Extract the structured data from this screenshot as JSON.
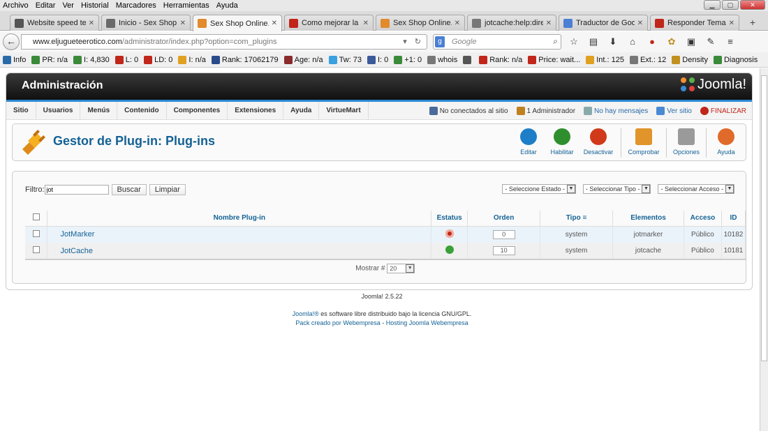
{
  "browser": {
    "menu": [
      "Archivo",
      "Editar",
      "Ver",
      "Historial",
      "Marcadores",
      "Herramientas",
      "Ayuda"
    ],
    "tabs": [
      {
        "label": "Website speed test",
        "color": "#555"
      },
      {
        "label": "Inicio - Sex Shop ...",
        "color": "#6a6a6a"
      },
      {
        "label": "Sex Shop Online. ...",
        "color": "#e28a2c",
        "active": true
      },
      {
        "label": "Como mejorar la ...",
        "color": "#c0261a"
      },
      {
        "label": "Sex Shop Online. ...",
        "color": "#e28a2c"
      },
      {
        "label": "jotcache:help:dire...",
        "color": "#777"
      },
      {
        "label": "Traductor de Goo...",
        "color": "#4a7fd4"
      },
      {
        "label": "Responder Tema: ...",
        "color": "#c0261a"
      }
    ],
    "url_host": "www.eljugueteerotico.com",
    "url_path": "/administrator/index.php?option=com_plugins",
    "search_placeholder": "Google",
    "seo": [
      {
        "label": "Info",
        "color": "#2a6aa8"
      },
      {
        "label": "PR: n/a",
        "color": "#3a8a3a"
      },
      {
        "label": "I: 4,830",
        "color": "#3a8a3a"
      },
      {
        "label": "L: 0",
        "color": "#c0261a"
      },
      {
        "label": "LD: 0",
        "color": "#c0261a"
      },
      {
        "label": "I: n/a",
        "color": "#e0a020"
      },
      {
        "label": "Rank: 17062179",
        "color": "#2a4a8a"
      },
      {
        "label": "Age: n/a",
        "color": "#8a2a2a"
      },
      {
        "label": "Tw: 73",
        "color": "#3aa0e0"
      },
      {
        "label": "I: 0",
        "color": "#3a5a9a"
      },
      {
        "label": "+1: 0",
        "color": "#3a8a3a"
      },
      {
        "label": "whois",
        "color": "#777"
      },
      {
        "label": "",
        "color": "#555"
      },
      {
        "label": "Rank: n/a",
        "color": "#c0261a"
      },
      {
        "label": "Price: wait...",
        "color": "#c0261a"
      },
      {
        "label": "Int.: 125",
        "color": "#e0a020"
      },
      {
        "label": "Ext.: 12",
        "color": "#777"
      },
      {
        "label": "Density",
        "color": "#555"
      },
      {
        "label": "Diagnosis",
        "color": "#3a8a3a"
      }
    ]
  },
  "joomla": {
    "admin_title": "Administración",
    "logo_text": "Joomla!",
    "menu": [
      "Sitio",
      "Usuarios",
      "Menús",
      "Contenido",
      "Componentes",
      "Extensiones",
      "Ayuda",
      "VirtueMart"
    ],
    "status": {
      "not_connected": "No conectados al sitio",
      "admins": "1 Administrador",
      "messages": "No hay mensajes",
      "view_site": "Ver sitio",
      "logout": "FINALIZAR"
    },
    "page_title": "Gestor de Plug-in: Plug-ins",
    "tools": [
      {
        "label": "Editar",
        "color": "#1e7fc8"
      },
      {
        "label": "Habilitar",
        "color": "#2f8f2f"
      },
      {
        "label": "Desactivar",
        "color": "#d03a1a"
      },
      {
        "label": "Comprobar",
        "color": "#e0942a"
      },
      {
        "label": "Opciones",
        "color": "#9a9a9a"
      },
      {
        "label": "Ayuda",
        "color": "#e06a2a"
      }
    ],
    "filter": {
      "label": "Filtro:",
      "value": "jot",
      "search_btn": "Buscar",
      "clear_btn": "Limpiar"
    },
    "selects": {
      "estado": "- Seleccione Estado -",
      "tipo": "- Seleccionar Tipo -",
      "acceso": "- Seleccionar Acceso -"
    },
    "columns": {
      "name": "Nombre Plug-in",
      "status": "Estatus",
      "order": "Orden",
      "type": "Tipo",
      "elements": "Elementos",
      "access": "Acceso",
      "id": "ID"
    },
    "rows": [
      {
        "name": "JotMarker",
        "status": "disabled",
        "order": "0",
        "type": "system",
        "element": "jotmarker",
        "access": "Público",
        "id": "10182"
      },
      {
        "name": "JotCache",
        "status": "enabled",
        "order": "10",
        "type": "system",
        "element": "jotcache",
        "access": "Público",
        "id": "10181"
      }
    ],
    "show_label": "Mostrar #",
    "show_value": "20",
    "version": "Joomla! 2.5.22",
    "footer_link1": "Joomla!®",
    "footer_text1": " es software libre distribuido bajo la licencia GNU/GPL.",
    "footer_link2": "Pack creado por Webempresa",
    "footer_sep": " - ",
    "footer_link3": "Hosting Joomla Webempresa"
  },
  "colors": {
    "accent": "#146295",
    "status_enabled": "#3aa03a",
    "status_disabled": "#c0261a"
  }
}
